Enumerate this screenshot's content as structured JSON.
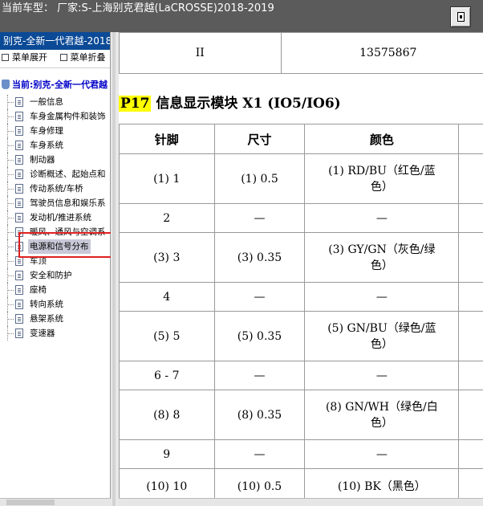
{
  "topbar": {
    "title": "当前车型：  厂家:S-上海别克君越(LaCROSSE)2018-2019"
  },
  "sidebar": {
    "header": "别克-全新一代君越-2018-",
    "tools": [
      "菜单展开",
      "菜单折叠"
    ],
    "root": "当前:别克-全新一代君越",
    "items": [
      {
        "label": "一般信息"
      },
      {
        "label": "车身金属构件和装饰"
      },
      {
        "label": "车身修理"
      },
      {
        "label": "车身系统"
      },
      {
        "label": "制动器"
      },
      {
        "label": "诊断概述、起始点和"
      },
      {
        "label": "传动系统/车桥"
      },
      {
        "label": "驾驶员信息和娱乐系"
      },
      {
        "label": "发动机/推进系统"
      },
      {
        "label": "暖风、通风与空调系"
      },
      {
        "label": "电源和信号分布"
      },
      {
        "label": "车顶"
      },
      {
        "label": "安全和防护"
      },
      {
        "label": "座椅"
      },
      {
        "label": "转向系统"
      },
      {
        "label": "悬架系统"
      },
      {
        "label": "变速器"
      }
    ],
    "selected_index": 10
  },
  "content": {
    "prev_row": {
      "col1": "II",
      "col2": "13575867"
    },
    "section": {
      "code": "P17",
      "title": "信息显示模块 X1 (IO5/IO6)"
    },
    "pin_table": {
      "headers": [
        "针脚",
        "尺寸",
        "颜色"
      ],
      "rows": [
        {
          "pin": "(1) 1",
          "size": "(1) 0.5",
          "color_line1": "(1) RD/BU（红色/蓝",
          "color_line2": "色）"
        },
        {
          "pin": "2",
          "size": "—",
          "color_line1": "—",
          "color_line2": ""
        },
        {
          "pin": "(3) 3",
          "size": "(3) 0.35",
          "color_line1": "(3) GY/GN（灰色/绿",
          "color_line2": "色）"
        },
        {
          "pin": "4",
          "size": "—",
          "color_line1": "—",
          "color_line2": ""
        },
        {
          "pin": "(5) 5",
          "size": "(5) 0.35",
          "color_line1": "(5) GN/BU（绿色/蓝",
          "color_line2": "色）"
        },
        {
          "pin": "6 - 7",
          "size": "—",
          "color_line1": "—",
          "color_line2": ""
        },
        {
          "pin": "(8) 8",
          "size": "(8) 0.35",
          "color_line1": "(8) GN/WH（绿色/白",
          "color_line2": "色）"
        },
        {
          "pin": "9",
          "size": "—",
          "color_line1": "—",
          "color_line2": ""
        },
        {
          "pin": "(10) 10",
          "size": "(10) 0.5",
          "color_line1": "(10) BK（黑色）",
          "color_line2": ""
        }
      ]
    }
  },
  "colors": {
    "titlebar": "#5b5b5b",
    "sidebar_header": "#0b4a96",
    "highlight": "#ffff00",
    "annotation_box": "#e02020"
  }
}
